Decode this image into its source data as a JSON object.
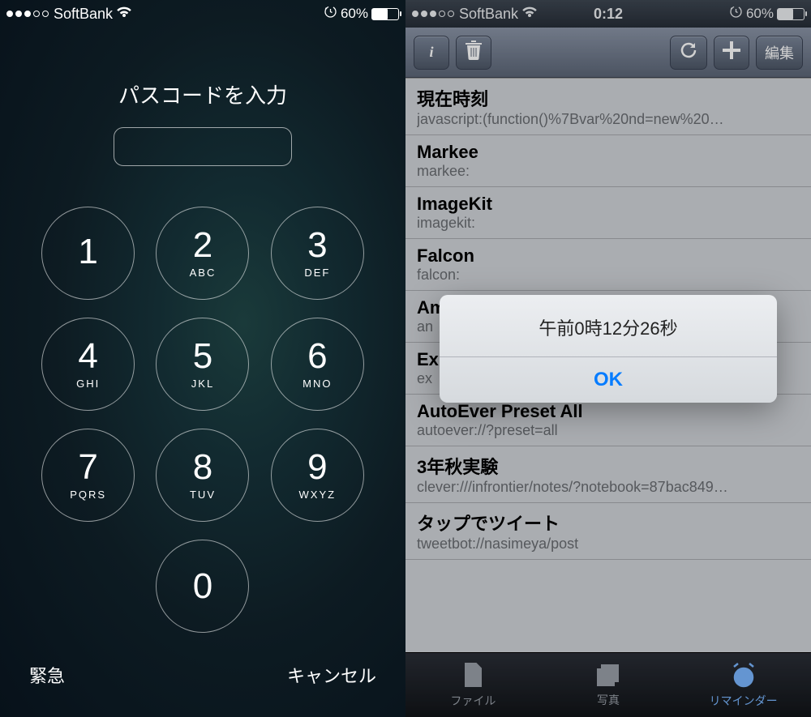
{
  "left": {
    "status": {
      "carrier": "SoftBank",
      "battery_pct": "60%",
      "battery_level": 60
    },
    "title": "パスコードを入力",
    "keys": [
      {
        "num": "1",
        "letters": ""
      },
      {
        "num": "2",
        "letters": "ABC"
      },
      {
        "num": "3",
        "letters": "DEF"
      },
      {
        "num": "4",
        "letters": "GHI"
      },
      {
        "num": "5",
        "letters": "JKL"
      },
      {
        "num": "6",
        "letters": "MNO"
      },
      {
        "num": "7",
        "letters": "PQRS"
      },
      {
        "num": "8",
        "letters": "TUV"
      },
      {
        "num": "9",
        "letters": "WXYZ"
      },
      {
        "num": "0",
        "letters": ""
      }
    ],
    "emergency": "緊急",
    "cancel": "キャンセル"
  },
  "right": {
    "status": {
      "carrier": "SoftBank",
      "time": "0:12",
      "battery_pct": "60%",
      "battery_level": 60
    },
    "nav": {
      "info": "i",
      "edit": "編集"
    },
    "list": [
      {
        "title": "現在時刻",
        "sub": "javascript:(function()%7Bvar%20nd=new%20…"
      },
      {
        "title": "Markee",
        "sub": "markee:"
      },
      {
        "title": "ImageKit",
        "sub": "imagekit:"
      },
      {
        "title": "Falcon",
        "sub": "falcon:"
      },
      {
        "title": "Am",
        "sub": "an"
      },
      {
        "title": "Ex",
        "sub": "ex"
      },
      {
        "title": "AutoEver Preset All",
        "sub": "autoever://?preset=all"
      },
      {
        "title": "3年秋実験",
        "sub": "clever:///infrontier/notes/?notebook=87bac849…"
      },
      {
        "title": "タップでツイート",
        "sub": "tweetbot://nasimeya/post"
      }
    ],
    "tabs": {
      "file": "ファイル",
      "photo": "写真",
      "reminder": "リマインダー"
    },
    "alert": {
      "message": "午前0時12分26秒",
      "ok": "OK"
    }
  }
}
